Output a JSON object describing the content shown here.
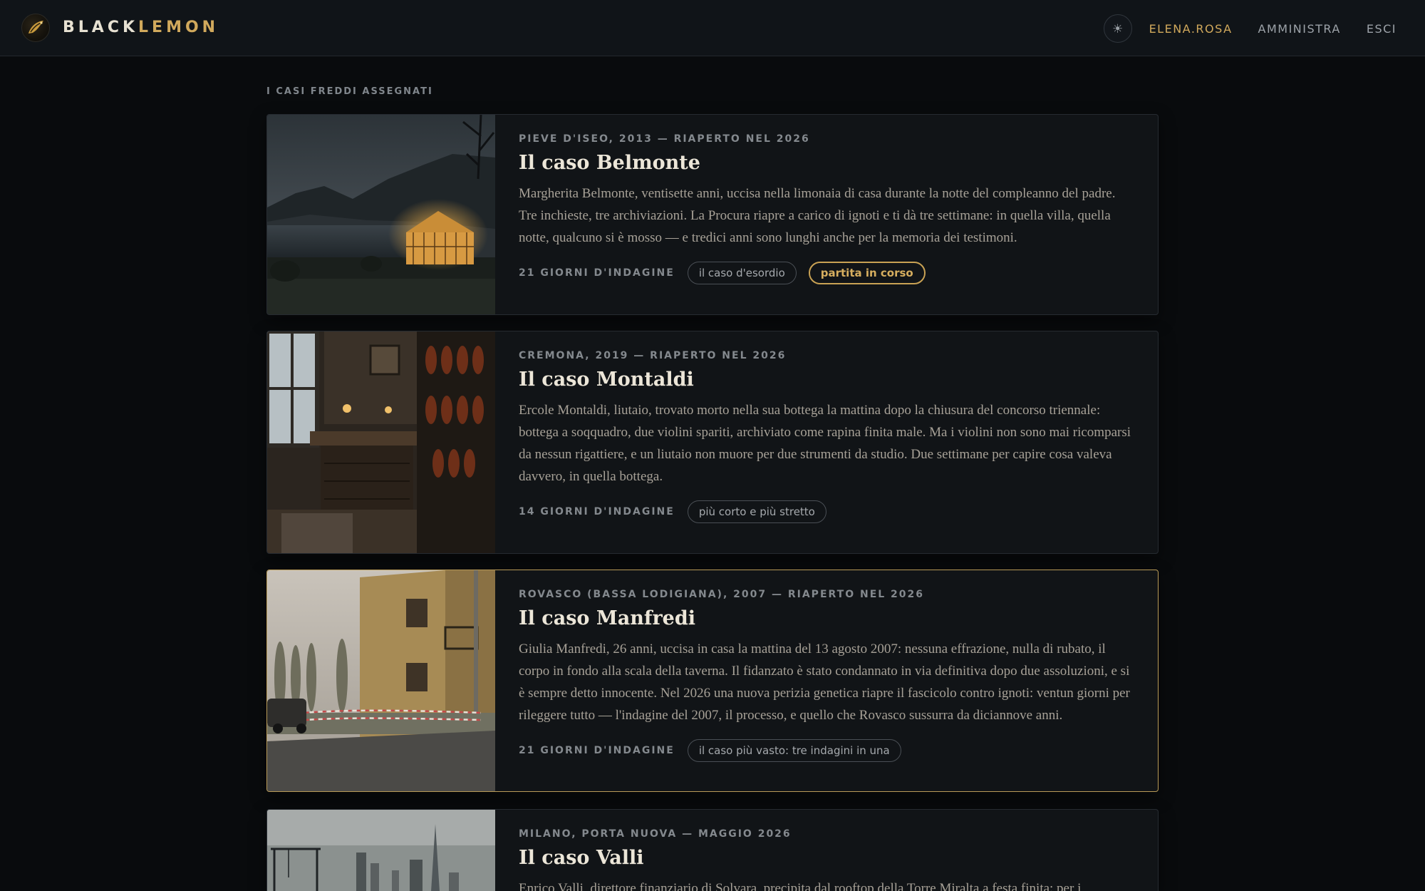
{
  "brand": {
    "part1": "BLACK",
    "part2": "LEMON",
    "logo_icon": "lemon-bird-logo"
  },
  "nav": {
    "theme_icon": "☀",
    "user": "ELENA.ROSA",
    "admin": "AMMINISTRA",
    "logout": "ESCI"
  },
  "section_title": "I CASI FREDDI ASSEGNATI",
  "colors": {
    "accent": "#d1a95c",
    "background": "#090b0d",
    "card": "#111417"
  },
  "cases": [
    {
      "meta": "PIEVE D'ISEO, 2013 — RIAPERTO NEL 2026",
      "title": "Il caso Belmonte",
      "description": "Margherita Belmonte, ventisette anni, uccisa nella limonaia di casa durante la notte del compleanno del padre. Tre inchieste, tre archiviazioni. La Procura riapre a carico di ignoti e ti dà tre settimane: in quella villa, quella notte, qualcuno si è mosso — e tredici anni sono lunghi anche per la memoria dei testimoni.",
      "duration": "21 GIORNI D'INDAGINE",
      "tags": [
        "il caso d'esordio"
      ],
      "status_tag": "partita in corso",
      "image": "lake-greenhouse-night"
    },
    {
      "meta": "CREMONA, 2019 — RIAPERTO NEL 2026",
      "title": "Il caso Montaldi",
      "description": "Ercole Montaldi, liutaio, trovato morto nella sua bottega la mattina dopo la chiusura del concorso triennale: bottega a soqquadro, due violini spariti, archiviato come rapina finita male. Ma i violini non sono mai ricomparsi da nessun rigattiere, e un liutaio non muore per due strumenti da studio. Due settimane per capire cosa valeva davvero, in quella bottega.",
      "duration": "14 GIORNI D'INDAGINE",
      "tags": [
        "più corto e più stretto"
      ],
      "image": "violin-workshop"
    },
    {
      "meta": "ROVASCO (BASSA LODIGIANA), 2007 — RIAPERTO NEL 2026",
      "title": "Il caso Manfredi",
      "description": "Giulia Manfredi, 26 anni, uccisa in casa la mattina del 13 agosto 2007: nessuna effrazione, nulla di rubato, il corpo in fondo alla scala della taverna. Il fidanzato è stato condannato in via definitiva dopo due assoluzioni, e si è sempre detto innocente. Nel 2026 una nuova perizia genetica riapre il fascicolo contro ignoti: ventun giorni per rileggere tutto — l'indagine del 2007, il processo, e quello che Rovasco sussurra da diciannove anni.",
      "duration": "21 GIORNI D'INDAGINE",
      "tags": [
        "il caso più vasto: tre indagini in una"
      ],
      "image": "house-crime-tape"
    },
    {
      "meta": "MILANO, PORTA NUOVA — MAGGIO 2026",
      "title": "Il caso Valli",
      "description": "Enrico Valli, direttore finanziario di Solvara, precipita dal rooftop della Torre Miralta a festa finita: per i",
      "image": "milan-skyline"
    }
  ]
}
